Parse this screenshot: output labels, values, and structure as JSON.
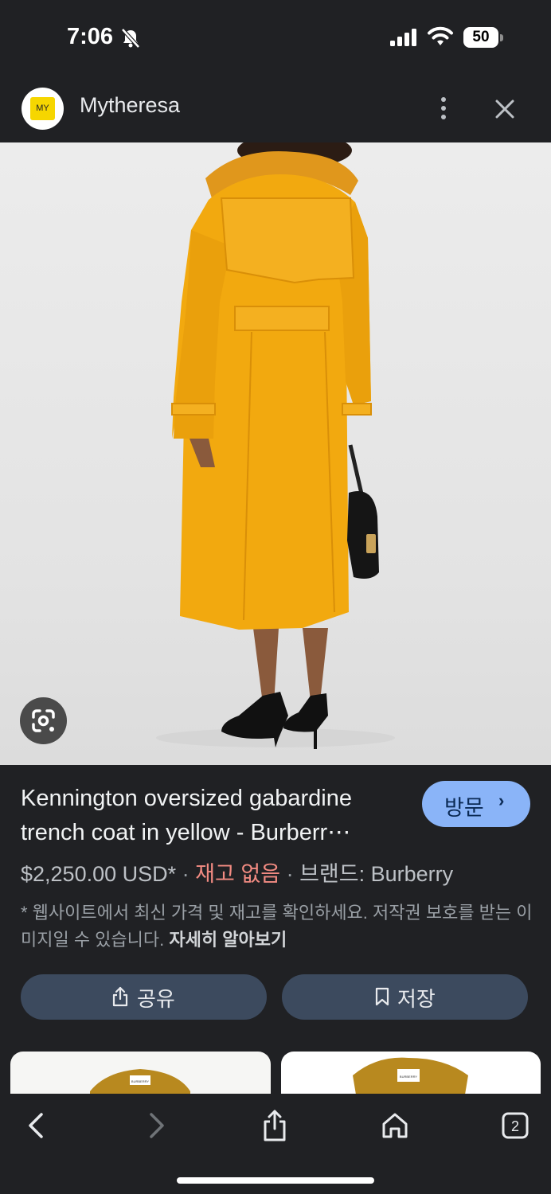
{
  "status_bar": {
    "time": "7:06",
    "battery": "50",
    "icons": [
      "bell-muted-icon",
      "cell-signal-icon",
      "wifi-icon",
      "battery-icon"
    ]
  },
  "site": {
    "logo_text": "MY",
    "name": "Mytheresa",
    "menu_icon": "more-vert-icon",
    "close_icon": "close-icon"
  },
  "product": {
    "title": "Kennington oversized gabardine trench coat in yellow - Burberr⋯",
    "visit_label": "방문",
    "price": "$2,250.00 USD*",
    "separator": "·",
    "stock_status": "재고 없음",
    "brand": "브랜드: Burberry",
    "disclaimer": "* 웹사이트에서 최신 가격 및 재고를 확인하세요. 저작권 보호를 받는 이미지일 수 있습니다.",
    "learn_more": "자세히 알아보기",
    "share_label": "공유",
    "save_label": "저장"
  },
  "thumbnails": {
    "label_1": "BURBERRY",
    "label_2": "BURBERRY"
  },
  "toolbar": {
    "tabs_count": "2",
    "icons": [
      "back-icon",
      "forward-icon",
      "share-icon",
      "home-icon",
      "tabs-icon"
    ]
  },
  "colors": {
    "background": "#202124",
    "accent": "#8ab4f8",
    "out_of_stock": "#f28b82",
    "coat": "#f2a90f",
    "button": "#3c4a5e"
  }
}
